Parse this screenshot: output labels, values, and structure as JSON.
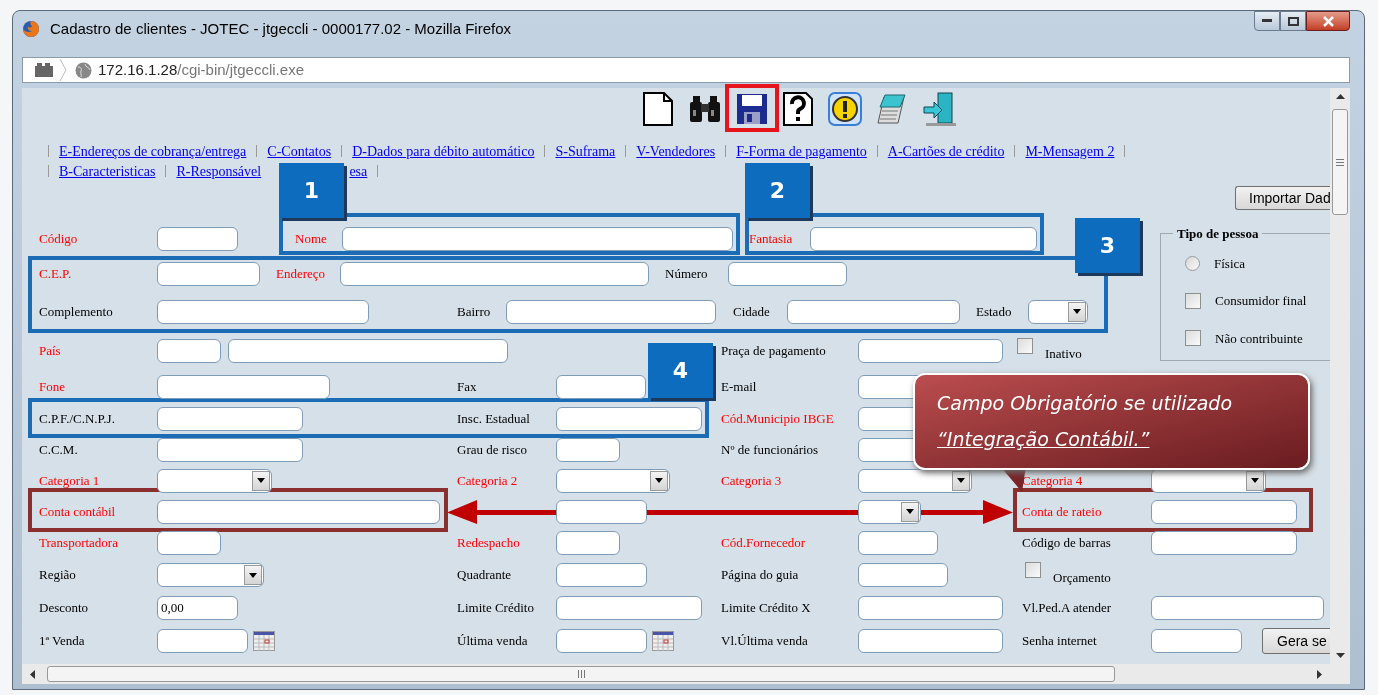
{
  "window": {
    "title": "Cadastro de clientes - JOTEC - jtgeccli - 0000177.02 - Mozilla Firefox"
  },
  "address": {
    "host": "172.16.1.28",
    "path": "/cgi-bin/jtgeccli.exe"
  },
  "link_rows": [
    [
      {
        "text": "E-Endereços de cobrança/entrega"
      },
      {
        "text": "C-Contatos"
      },
      {
        "text": "D-Dados para débito automático"
      },
      {
        "text": "S-Suframa"
      },
      {
        "text": "V-Vendedores"
      },
      {
        "text": "F-Forma de pagamento"
      },
      {
        "text": "A-Cartões de crédito"
      },
      {
        "text": "M-Mensagem 2"
      }
    ],
    [
      {
        "text": "B-Caracteristicas"
      },
      {
        "text": "R-Responsável",
        "tail": "esa"
      }
    ]
  ],
  "import_button": "Importar Dad",
  "person_type": {
    "legend": "Tipo de pessoa",
    "options": [
      {
        "kind": "radio",
        "label": "Física",
        "selected": false
      },
      {
        "kind": "checkbox",
        "label": "Consumidor final",
        "checked": false
      },
      {
        "kind": "checkbox",
        "label": "Não contribuinte",
        "checked": false
      }
    ]
  },
  "top_rows": [
    [
      {
        "label": "Código",
        "required": true,
        "kind": "text"
      },
      {
        "label": "Nome",
        "required": true,
        "kind": "text"
      },
      {
        "label": "Fantasia",
        "required": true,
        "kind": "text"
      }
    ],
    [
      {
        "label": "C.E.P.",
        "required": true,
        "kind": "text"
      },
      {
        "label": "Endereço",
        "required": true,
        "kind": "text"
      },
      {
        "label": "Número",
        "required": false,
        "kind": "text"
      }
    ],
    [
      {
        "label": "Complemento",
        "required": false,
        "kind": "text"
      },
      {
        "label": "Bairro",
        "required": false,
        "kind": "text"
      },
      {
        "label": "Cidade",
        "required": false,
        "kind": "text"
      },
      {
        "label": "Estado",
        "required": false,
        "kind": "select"
      }
    ],
    [
      {
        "label": "País",
        "required": true,
        "kind": "pair"
      },
      {
        "label": "Praça de pagamento",
        "required": false,
        "kind": "text"
      },
      {
        "label": "Inativo",
        "required": false,
        "kind": "checkbox",
        "checked": false
      }
    ]
  ],
  "rows": [
    [
      {
        "label": "Fone",
        "required": true,
        "kind": "text"
      },
      {
        "label": "Fax",
        "required": false,
        "kind": "text"
      },
      {
        "label": "E-mail",
        "required": false,
        "kind": "text"
      }
    ],
    [
      {
        "label": "C.P.F./C.N.P.J.",
        "required": false,
        "kind": "text"
      },
      {
        "label": "Insc. Estadual",
        "required": false,
        "kind": "text"
      },
      {
        "label": "Cód.Municipio IBGE",
        "required": true,
        "kind": "text"
      }
    ],
    [
      {
        "label": "C.C.M.",
        "required": false,
        "kind": "text"
      },
      {
        "label": "Grau de risco",
        "required": false,
        "kind": "text"
      },
      {
        "label": "Nº de funcionários",
        "required": false,
        "kind": "text"
      }
    ],
    [
      {
        "label": "Categoria 1",
        "required": true,
        "kind": "select"
      },
      {
        "label": "Categoria 2",
        "required": true,
        "kind": "select"
      },
      {
        "label": "Categoria 3",
        "required": true,
        "kind": "select"
      },
      {
        "label": "Categoria 4",
        "required": true,
        "kind": "select"
      }
    ],
    [
      {
        "label": "Conta contábil",
        "required": true,
        "kind": "text"
      },
      {
        "kind": "text"
      },
      {
        "kind": "select"
      },
      {
        "label": "Conta de rateio",
        "required": true,
        "kind": "text"
      }
    ],
    [
      {
        "label": "Transportadora",
        "required": true,
        "kind": "text"
      },
      {
        "label": "Redespacho",
        "required": true,
        "kind": "text"
      },
      {
        "label": "Cód.Fornecedor",
        "required": true,
        "kind": "text"
      },
      {
        "label": "Código de barras",
        "required": false,
        "kind": "text"
      }
    ],
    [
      {
        "label": "Região",
        "required": false,
        "kind": "select"
      },
      {
        "label": "Quadrante",
        "required": false,
        "kind": "text"
      },
      {
        "label": "Página do guia",
        "required": false,
        "kind": "text"
      },
      {
        "label": "Orçamento",
        "required": false,
        "kind": "checkbox",
        "checked": false
      }
    ],
    [
      {
        "label": "Desconto",
        "required": false,
        "kind": "text",
        "value": "0,00"
      },
      {
        "label": "Limite Crédito",
        "required": false,
        "kind": "text"
      },
      {
        "label": "Limite Crédito X",
        "required": false,
        "kind": "text"
      },
      {
        "label": "Vl.Ped.A atender",
        "required": false,
        "kind": "text"
      }
    ],
    [
      {
        "label": "1ª Venda",
        "required": false,
        "kind": "date"
      },
      {
        "label": "Última venda",
        "required": false,
        "kind": "date"
      },
      {
        "label": "Vl.Última venda",
        "required": false,
        "kind": "text"
      },
      {
        "label": "Senha internet",
        "required": false,
        "kind": "text-button",
        "button": "Gera se"
      }
    ]
  ],
  "badges": [
    {
      "text": "1"
    },
    {
      "text": "2"
    },
    {
      "text": "3"
    },
    {
      "text": "4"
    }
  ],
  "callout": {
    "text": "Campo Obrigatório se utilizado",
    "emphasis": "“Integração Contábil.”"
  }
}
